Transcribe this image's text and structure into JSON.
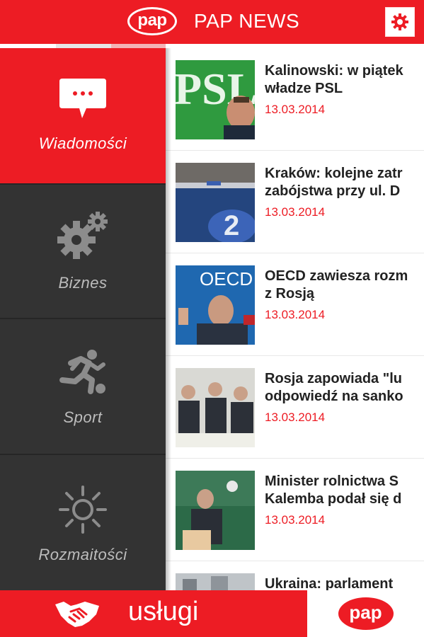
{
  "header": {
    "logo_text": "pap",
    "title": "PAP NEWS"
  },
  "sidebar": {
    "items": [
      {
        "label": "Wiadomości",
        "icon": "chat-bubble-icon",
        "active": true
      },
      {
        "label": "Biznes",
        "icon": "gears-icon",
        "active": false
      },
      {
        "label": "Sport",
        "icon": "runner-icon",
        "active": false
      },
      {
        "label": "Rozmaitości",
        "icon": "sun-icon",
        "active": false
      }
    ]
  },
  "news": {
    "items": [
      {
        "line1": "Kalinowski: w piątek",
        "line2": "władze PSL",
        "date": "13.03.2014"
      },
      {
        "line1": "Kraków: kolejne zatr",
        "line2": "zabójstwa przy ul. D",
        "date": "13.03.2014"
      },
      {
        "line1": "OECD zawiesza rozm",
        "line2": "z Rosją",
        "date": "13.03.2014"
      },
      {
        "line1": "Rosja zapowiada \"lu",
        "line2": "odpowiedź na sanko",
        "date": "13.03.2014"
      },
      {
        "line1": "Minister rolnictwa S",
        "line2": "Kalemba podał się d",
        "date": "13.03.2014"
      },
      {
        "line1": "Ukraina: parlament",
        "line2": "",
        "date": ""
      }
    ]
  },
  "bottom": {
    "services_label": "usługi",
    "logo_text": "pap"
  },
  "colors": {
    "brand_red": "#ed1c24",
    "sidebar_dark": "#333333",
    "date_red": "#ed1c24"
  }
}
